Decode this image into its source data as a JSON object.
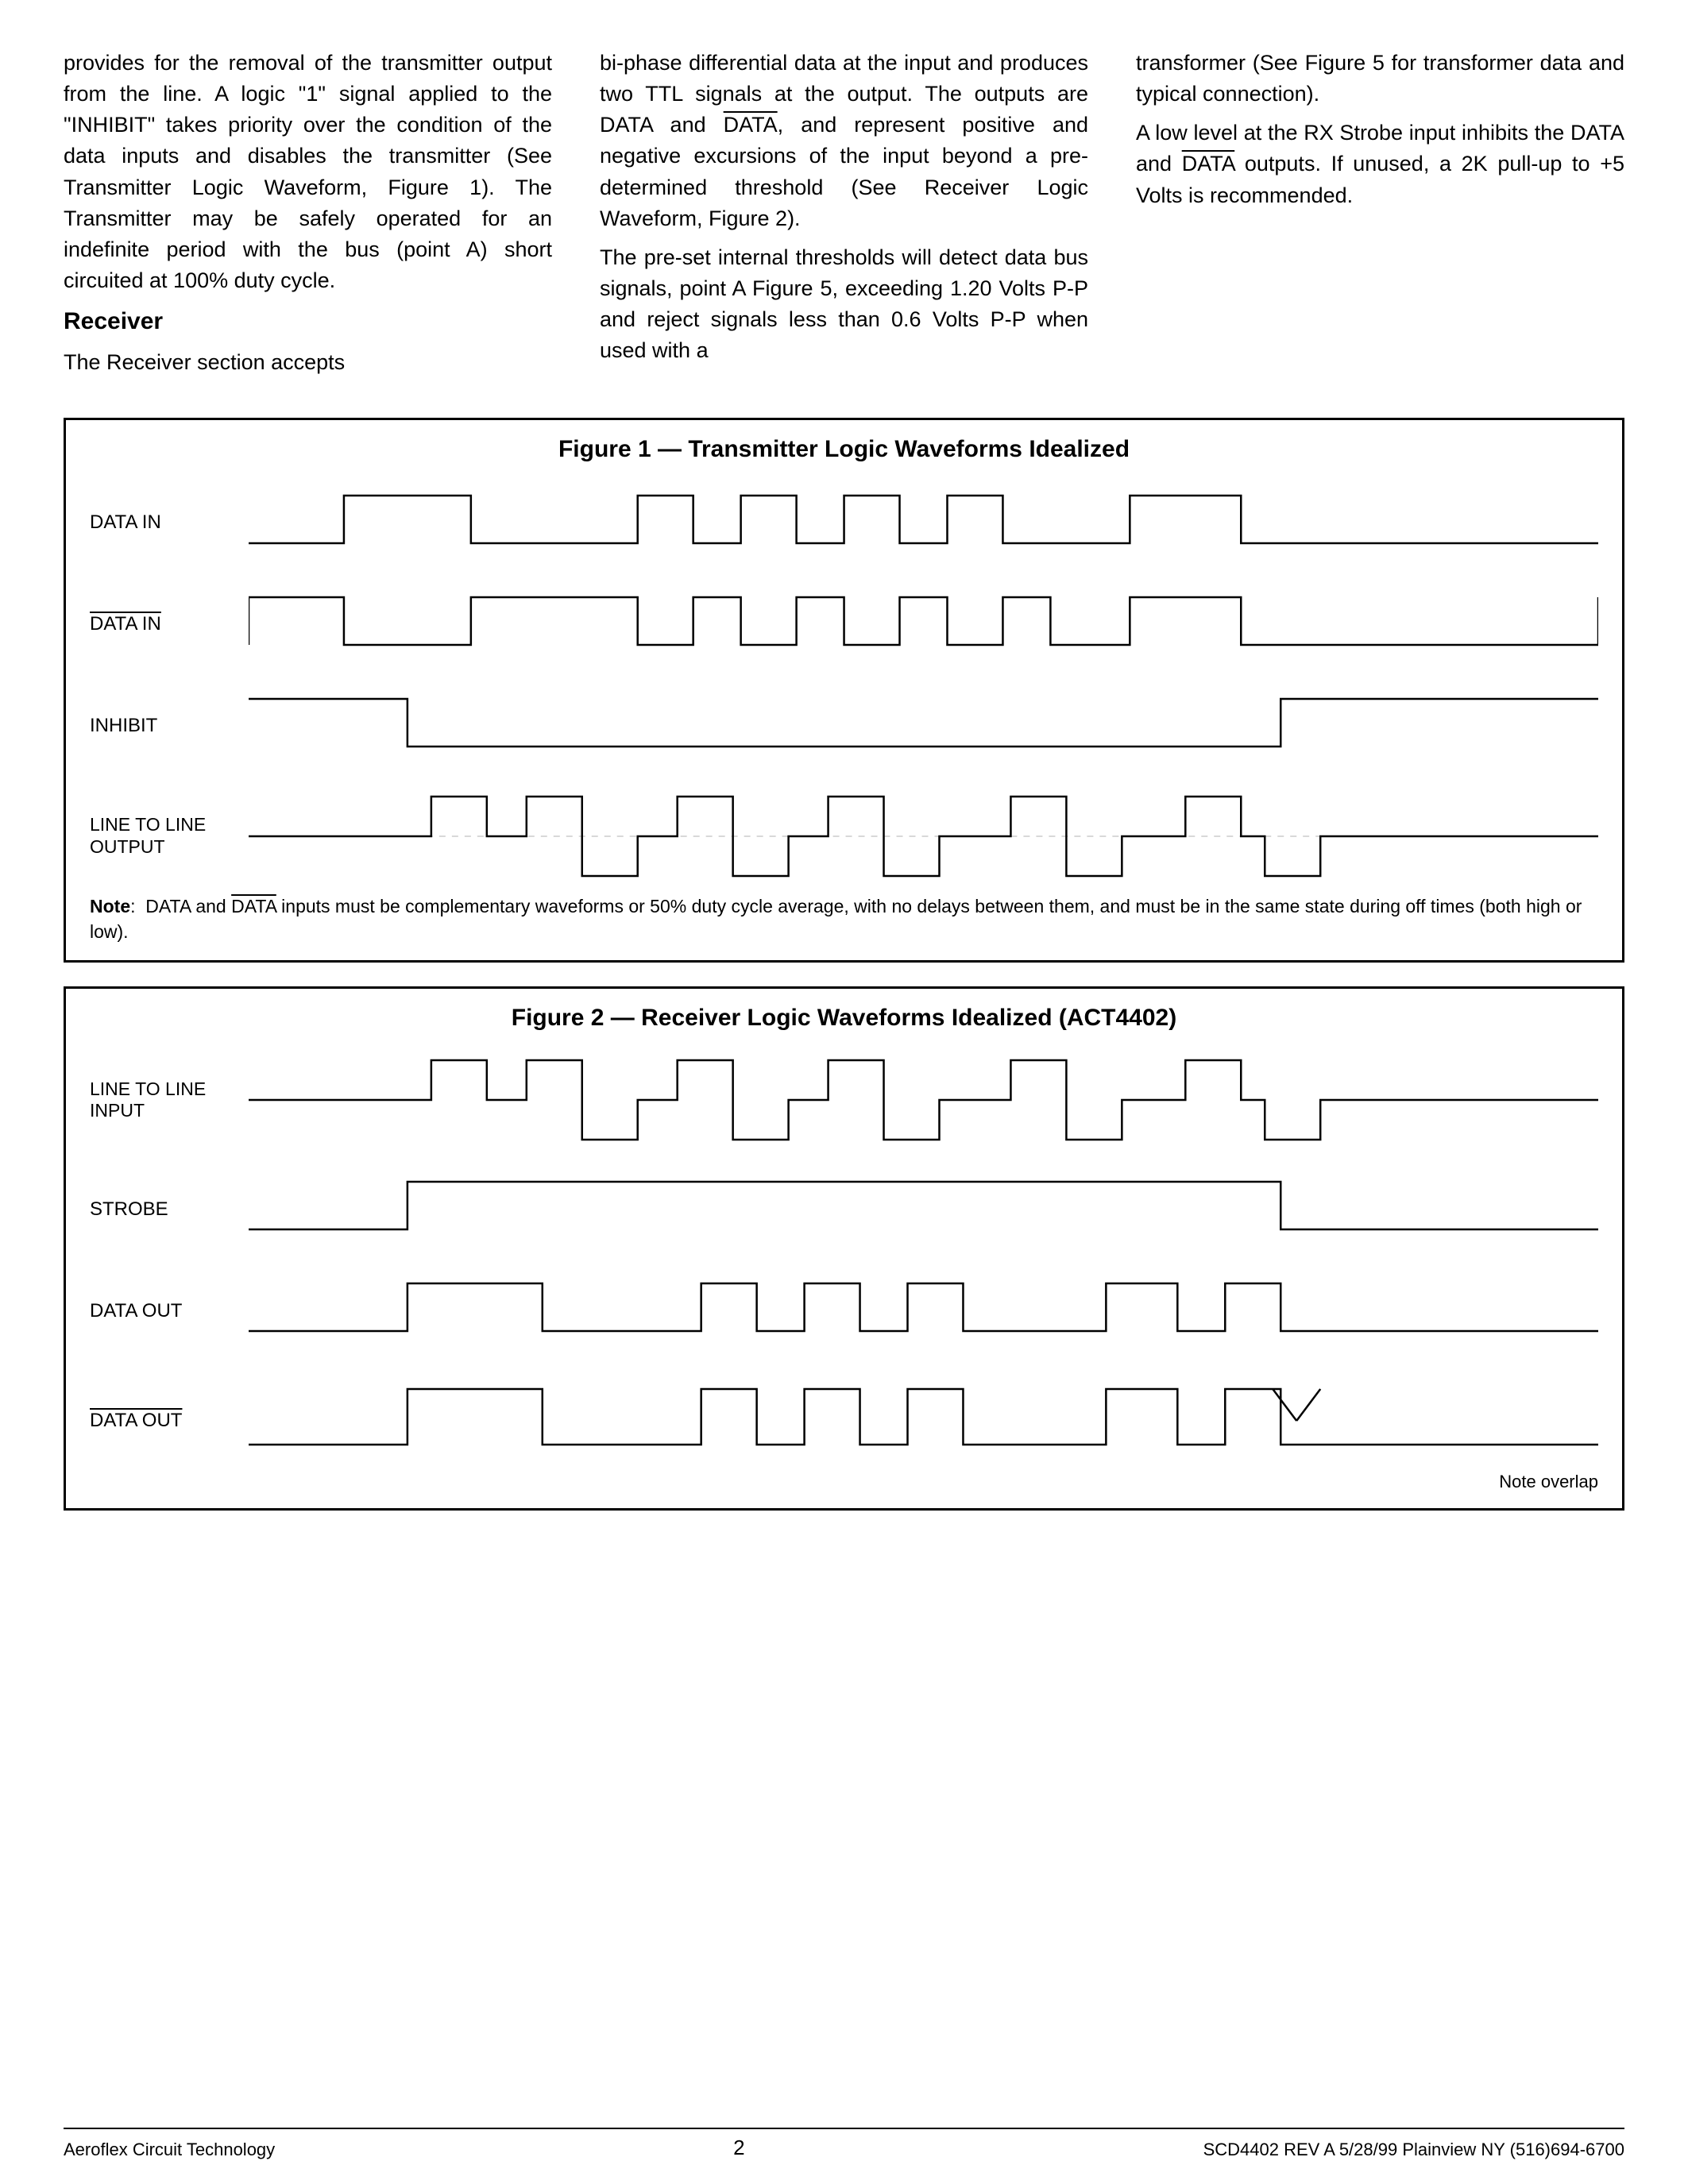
{
  "figure1": {
    "title": "Figure 1 — Transmitter Logic Waveforms Idealized"
  },
  "figure2": {
    "title": "Figure 2 — Receiver Logic Waveforms Idealized (ACT4402)"
  },
  "footer": {
    "left": "Aeroflex Circuit Technology",
    "center": "2",
    "right": "SCD4402 REV A  5/28/99  Plainview NY (516)694-6700"
  }
}
